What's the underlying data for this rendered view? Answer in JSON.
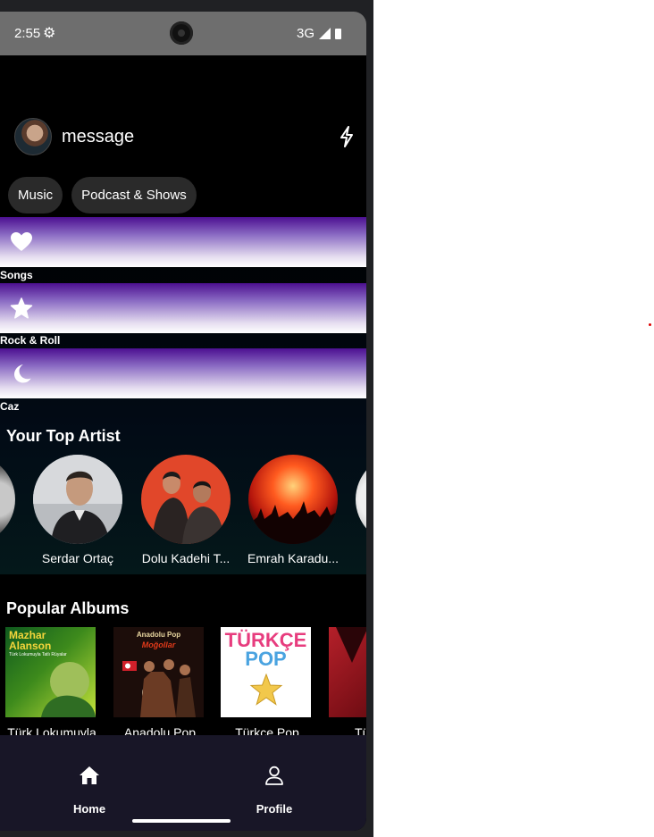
{
  "status_bar": {
    "time": "2:55",
    "network": "3G"
  },
  "header": {
    "title": "message"
  },
  "chips": [
    {
      "label": "Music"
    },
    {
      "label": "Podcast & Shows"
    }
  ],
  "playlists": [
    {
      "label": "Songs",
      "icon": "heart-icon"
    },
    {
      "label": "Rock & Roll",
      "icon": "star-icon"
    },
    {
      "label": "Caz",
      "icon": "moon-icon"
    }
  ],
  "top_artists": {
    "title": "Your Top Artist",
    "items": [
      {
        "name": "Serdar Ortaç"
      },
      {
        "name": "Dolu Kadehi T..."
      },
      {
        "name": "Emrah Karadu..."
      }
    ]
  },
  "popular_albums": {
    "title": "Popular Albums",
    "items": [
      {
        "title": "Türk Lokumuyla",
        "cover_text": "Mazhar Alanson",
        "cover_subtext": "Türk Lokumuyla Tatlı Rüyalar"
      },
      {
        "title": "Anadolu Pop",
        "cover_text": "Anadolu Pop",
        "cover_subtext": "Moğollar"
      },
      {
        "title": "Türkçe Pop",
        "cover_text": "TÜRKÇE",
        "cover_subtext": "POP"
      },
      {
        "title": "Türkiye"
      }
    ]
  },
  "bottom_nav": [
    {
      "label": "Home",
      "icon": "home-icon"
    },
    {
      "label": "Profile",
      "icon": "person-icon"
    }
  ],
  "colors": {
    "accent_purple": "#4c0f91",
    "nav_bg": "#181627"
  }
}
